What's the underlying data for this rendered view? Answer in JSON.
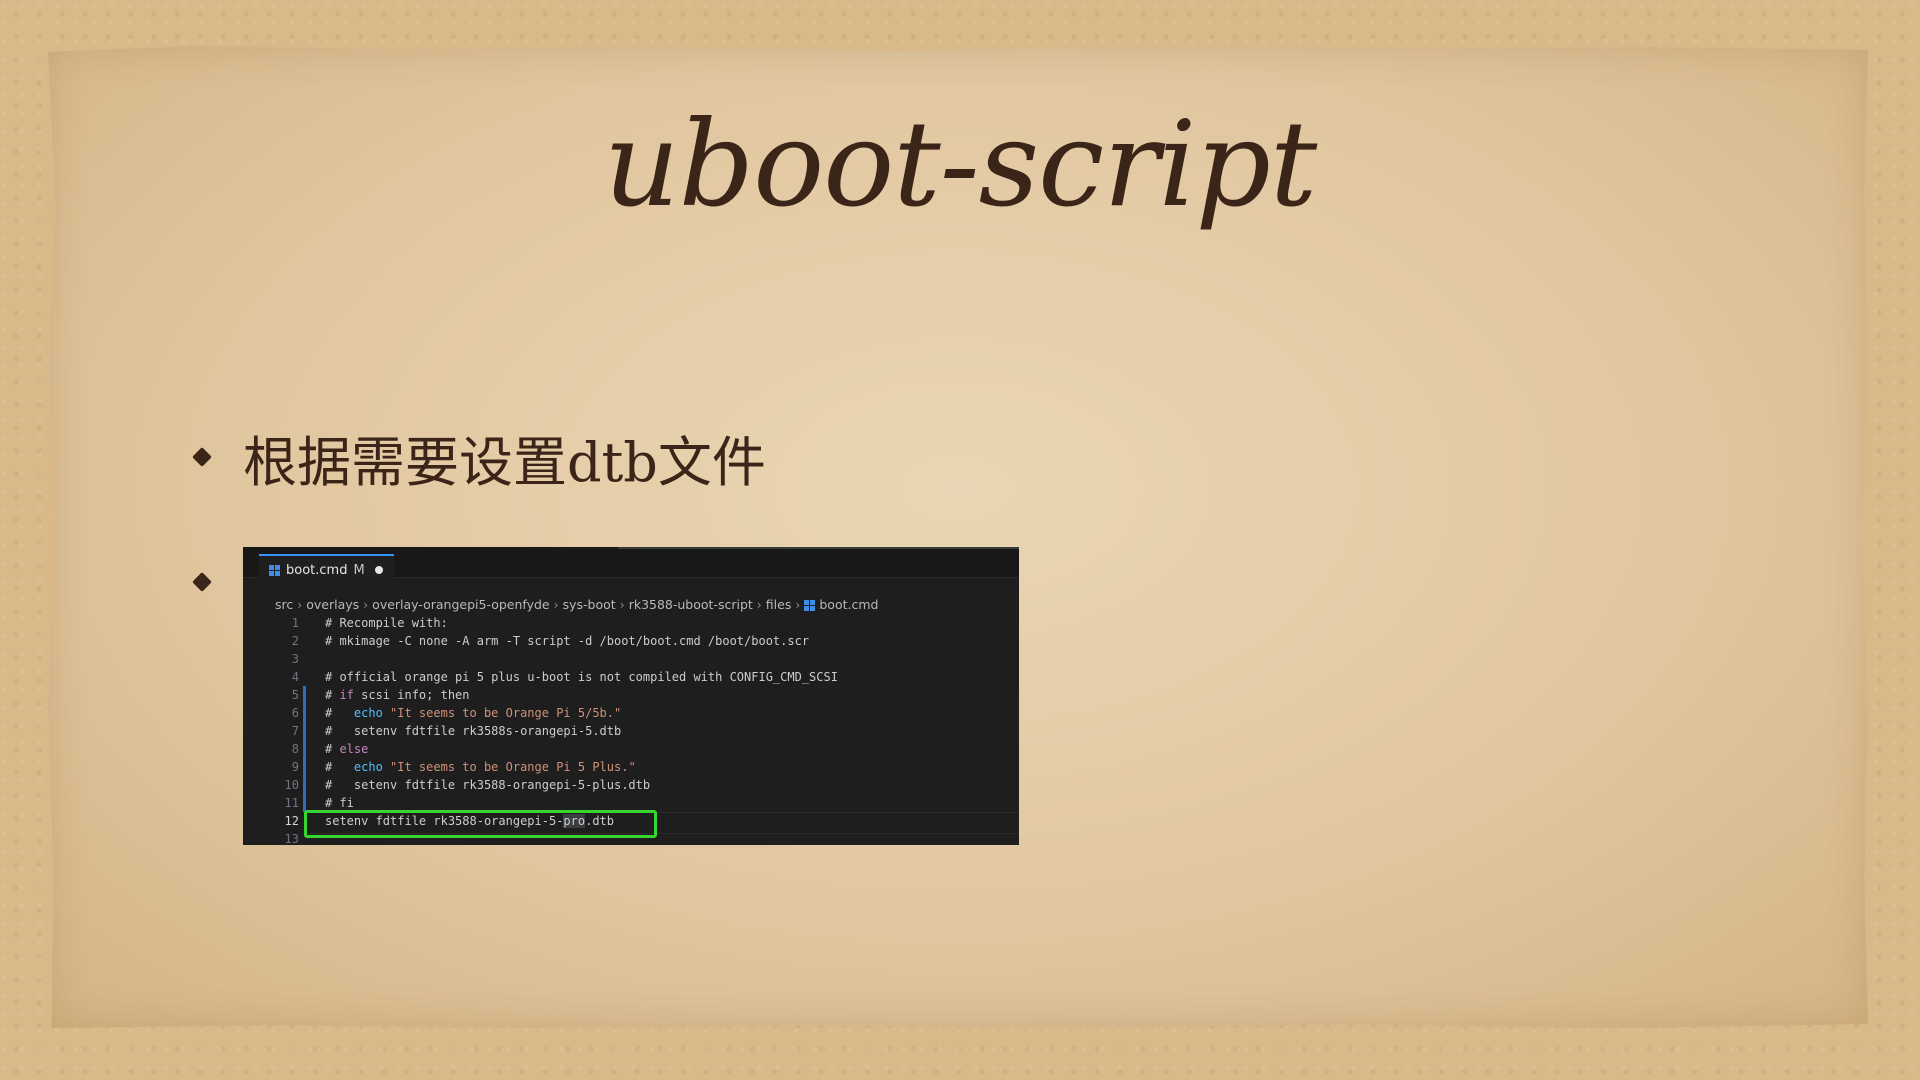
{
  "slide": {
    "title": "uboot-script",
    "bullet1": "根据需要设置dtb文件"
  },
  "editor": {
    "tab": {
      "name": "boot.cmd",
      "status": "M",
      "icon": "windows-file-icon"
    },
    "breadcrumbs": [
      "src",
      "overlays",
      "overlay-orangepi5-openfyde",
      "sys-boot",
      "rk3588-uboot-script",
      "files",
      "boot.cmd"
    ],
    "lines": [
      {
        "n": "1",
        "segs": [
          {
            "t": "# Recompile with:",
            "c": ""
          }
        ]
      },
      {
        "n": "2",
        "segs": [
          {
            "t": "# mkimage -C none -A arm -T script -d /boot/boot.cmd /boot/boot.scr",
            "c": ""
          }
        ]
      },
      {
        "n": "3",
        "segs": [
          {
            "t": "",
            "c": ""
          }
        ]
      },
      {
        "n": "4",
        "segs": [
          {
            "t": "# official orange pi 5 plus u-boot is not compiled with CONFIG_CMD_SCSI",
            "c": ""
          }
        ]
      },
      {
        "n": "5",
        "segs": [
          {
            "t": "# ",
            "c": ""
          },
          {
            "t": "if",
            "c": "kw"
          },
          {
            "t": " scsi info; then",
            "c": ""
          }
        ]
      },
      {
        "n": "6",
        "segs": [
          {
            "t": "#   ",
            "c": ""
          },
          {
            "t": "echo",
            "c": "fn"
          },
          {
            "t": " \"It seems to be Orange Pi 5/5b.\"",
            "c": "str"
          }
        ]
      },
      {
        "n": "7",
        "segs": [
          {
            "t": "#   setenv fdtfile rk3588s-orangepi-5.dtb",
            "c": ""
          }
        ]
      },
      {
        "n": "8",
        "segs": [
          {
            "t": "# ",
            "c": ""
          },
          {
            "t": "else",
            "c": "kw"
          }
        ]
      },
      {
        "n": "9",
        "segs": [
          {
            "t": "#   ",
            "c": ""
          },
          {
            "t": "echo",
            "c": "fn"
          },
          {
            "t": " \"It seems to be Orange Pi 5 Plus.\"",
            "c": "str"
          }
        ]
      },
      {
        "n": "10",
        "segs": [
          {
            "t": "#   setenv fdtfile rk3588-orangepi-5-plus.dtb",
            "c": ""
          }
        ]
      },
      {
        "n": "11",
        "segs": [
          {
            "t": "# fi",
            "c": ""
          }
        ]
      },
      {
        "n": "12",
        "segs": [
          {
            "t": "setenv fdtfile rk3588-orangepi-5-",
            "c": ""
          },
          {
            "t": "pro",
            "c": "hl"
          },
          {
            "t": ".dtb",
            "c": ""
          }
        ]
      },
      {
        "n": "13",
        "segs": [
          {
            "t": "",
            "c": ""
          }
        ]
      }
    ],
    "active_line": "12",
    "highlight_color": "#38d430"
  }
}
